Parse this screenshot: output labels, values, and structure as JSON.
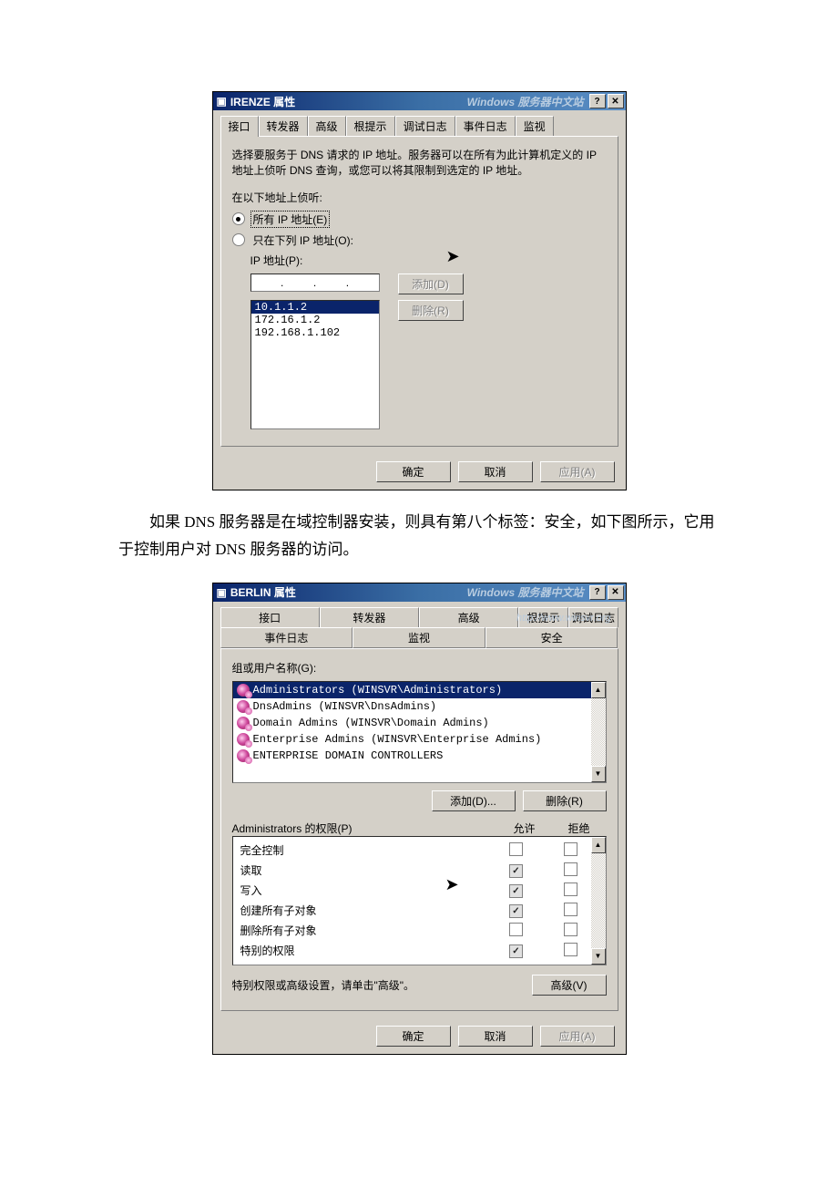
{
  "dialog1": {
    "title": "IRENZE 属性",
    "watermark": "Windows 服务器中文站",
    "tabs": [
      "接口",
      "转发器",
      "高级",
      "根提示",
      "调试日志",
      "事件日志",
      "监视"
    ],
    "description": "选择要服务于 DNS 请求的 IP 地址。服务器可以在所有为此计算机定义的 IP 地址上侦听 DNS 查询，或您可以将其限制到选定的 IP 地址。",
    "listen_label": "在以下地址上侦听:",
    "radio_all": "所有 IP 地址(E)",
    "radio_only": "只在下列 IP 地址(O):",
    "ip_label": "IP 地址(P):",
    "add_btn": "添加(D)",
    "remove_btn": "删除(R)",
    "ips": [
      "10.1.1.2",
      "172.16.1.2",
      "192.168.1.102"
    ],
    "ok": "确定",
    "cancel": "取消",
    "apply": "应用(A)"
  },
  "paragraph": "　　如果 DNS 服务器是在域控制器安装，则具有第八个标签：安全，如下图所示，它用于控制用户对 DNS 服务器的访问。",
  "dialog2": {
    "title": "BERLIN 属性",
    "watermark1": "Windows 服务器中文站",
    "watermark2": "http://www.winsvr.org",
    "tabs_row1": [
      "接口",
      "转发器",
      "高级",
      "根提示",
      "调试日志"
    ],
    "tabs_row2": [
      "事件日志",
      "监视",
      "安全"
    ],
    "group_label": "组或用户名称(G):",
    "groups": [
      "Administrators (WINSVR\\Administrators)",
      "DnsAdmins (WINSVR\\DnsAdmins)",
      "Domain Admins (WINSVR\\Domain Admins)",
      "Enterprise Admins (WINSVR\\Enterprise Admins)",
      "ENTERPRISE DOMAIN CONTROLLERS"
    ],
    "add_btn": "添加(D)...",
    "remove_btn": "删除(R)",
    "perm_label": "Administrators 的权限(P)",
    "allow": "允许",
    "deny": "拒绝",
    "permissions": [
      {
        "name": "完全控制",
        "allow": false,
        "a_grey": false,
        "deny": false
      },
      {
        "name": "读取",
        "allow": true,
        "a_grey": true,
        "deny": false
      },
      {
        "name": "写入",
        "allow": true,
        "a_grey": true,
        "deny": false
      },
      {
        "name": "创建所有子对象",
        "allow": true,
        "a_grey": true,
        "deny": false
      },
      {
        "name": "删除所有子对象",
        "allow": false,
        "a_grey": false,
        "deny": false
      },
      {
        "name": "特别的权限",
        "allow": true,
        "a_grey": true,
        "deny": false
      }
    ],
    "adv_text": "特别权限或高级设置，请单击\"高级\"。",
    "adv_btn": "高级(V)",
    "ok": "确定",
    "cancel": "取消",
    "apply": "应用(A)"
  }
}
